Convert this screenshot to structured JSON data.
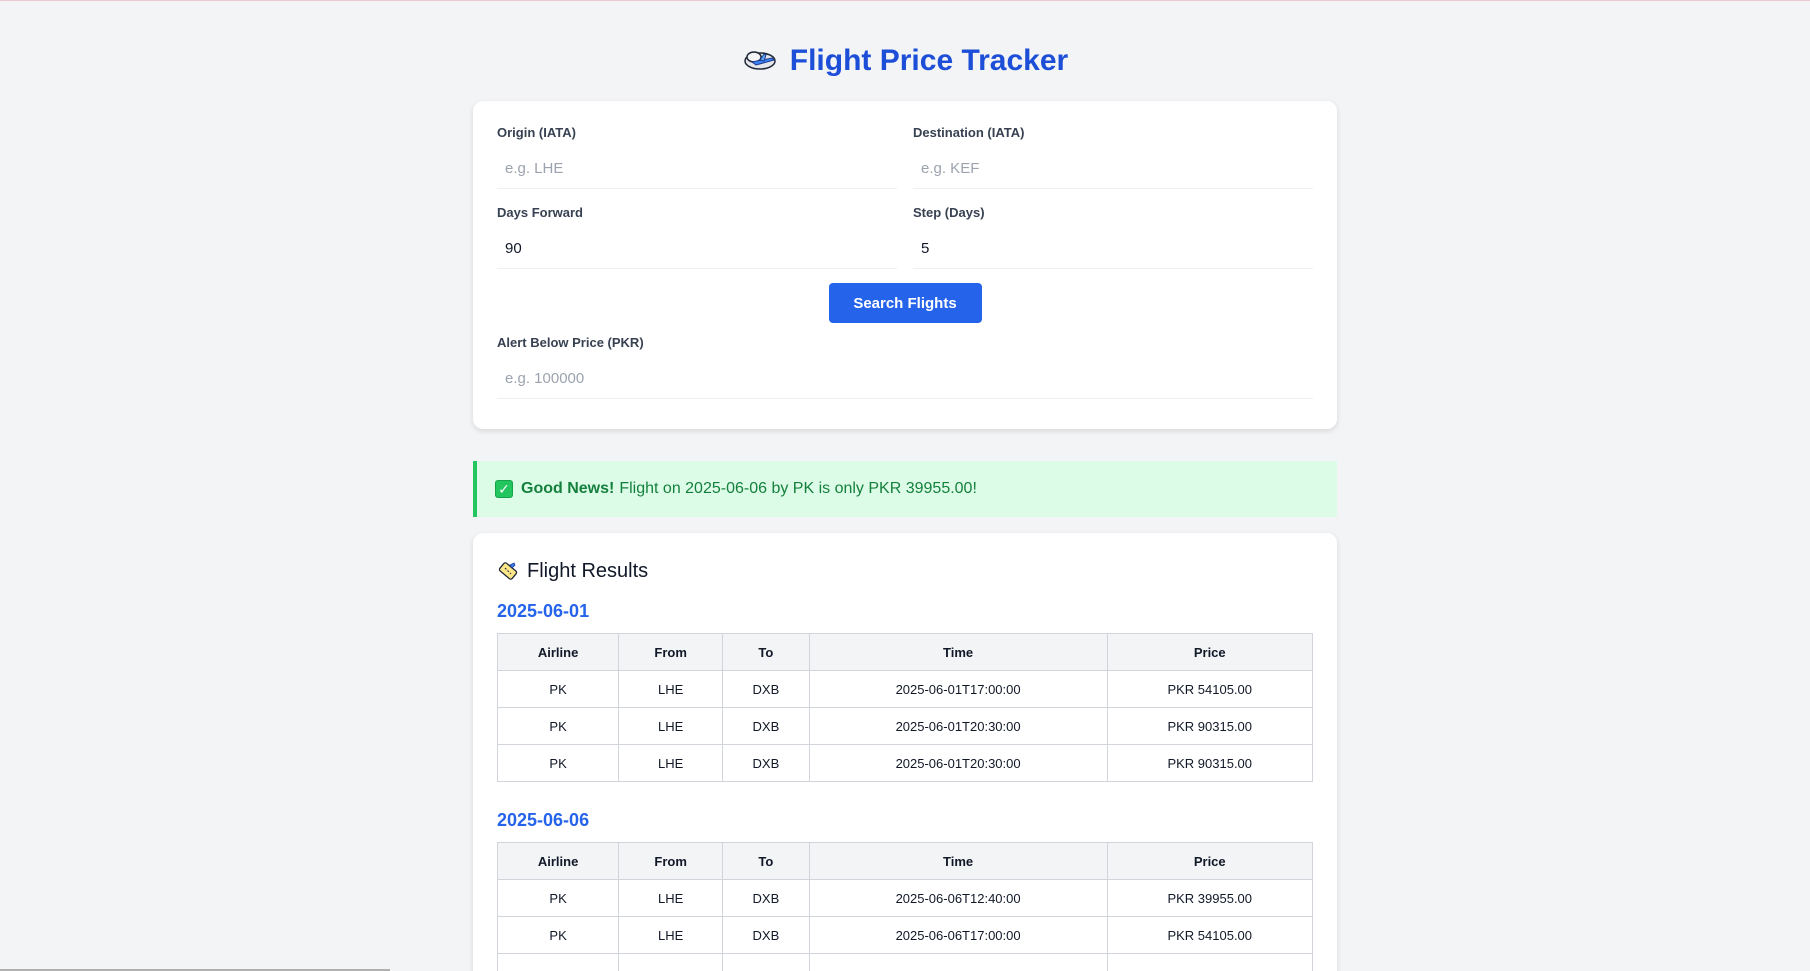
{
  "app": {
    "title": "Flight Price Tracker"
  },
  "form": {
    "origin": {
      "label": "Origin (IATA)",
      "placeholder": "e.g. LHE",
      "value": ""
    },
    "destination": {
      "label": "Destination (IATA)",
      "placeholder": "e.g. KEF",
      "value": ""
    },
    "days_forward": {
      "label": "Days Forward",
      "placeholder": "",
      "value": "90"
    },
    "step_days": {
      "label": "Step (Days)",
      "placeholder": "",
      "value": "5"
    },
    "search_button": "Search Flights",
    "alert_price": {
      "label": "Alert Below Price (PKR)",
      "placeholder": "e.g. 100000",
      "value": ""
    }
  },
  "alert": {
    "icon": "check-icon",
    "strong": "Good News!",
    "message": "Flight on 2025-06-06 by PK is only PKR 39955.00!",
    "color": "#15803d",
    "background": "#dcfce7"
  },
  "results": {
    "heading": "Flight Results",
    "columns": [
      "Airline",
      "From",
      "To",
      "Time",
      "Price"
    ],
    "groups": [
      {
        "date": "2025-06-01",
        "rows": [
          [
            "PK",
            "LHE",
            "DXB",
            "2025-06-01T17:00:00",
            "PKR 54105.00"
          ],
          [
            "PK",
            "LHE",
            "DXB",
            "2025-06-01T20:30:00",
            "PKR 90315.00"
          ],
          [
            "PK",
            "LHE",
            "DXB",
            "2025-06-01T20:30:00",
            "PKR 90315.00"
          ]
        ]
      },
      {
        "date": "2025-06-06",
        "rows": [
          [
            "PK",
            "LHE",
            "DXB",
            "2025-06-06T12:40:00",
            "PKR 39955.00"
          ],
          [
            "PK",
            "LHE",
            "DXB",
            "2025-06-06T17:00:00",
            "PKR 54105.00"
          ],
          [
            "",
            "",
            "",
            "",
            ""
          ]
        ]
      }
    ]
  },
  "colors": {
    "accent": "#1d4ed8",
    "button": "#2563eb",
    "page_bg": "#f3f4f6"
  }
}
